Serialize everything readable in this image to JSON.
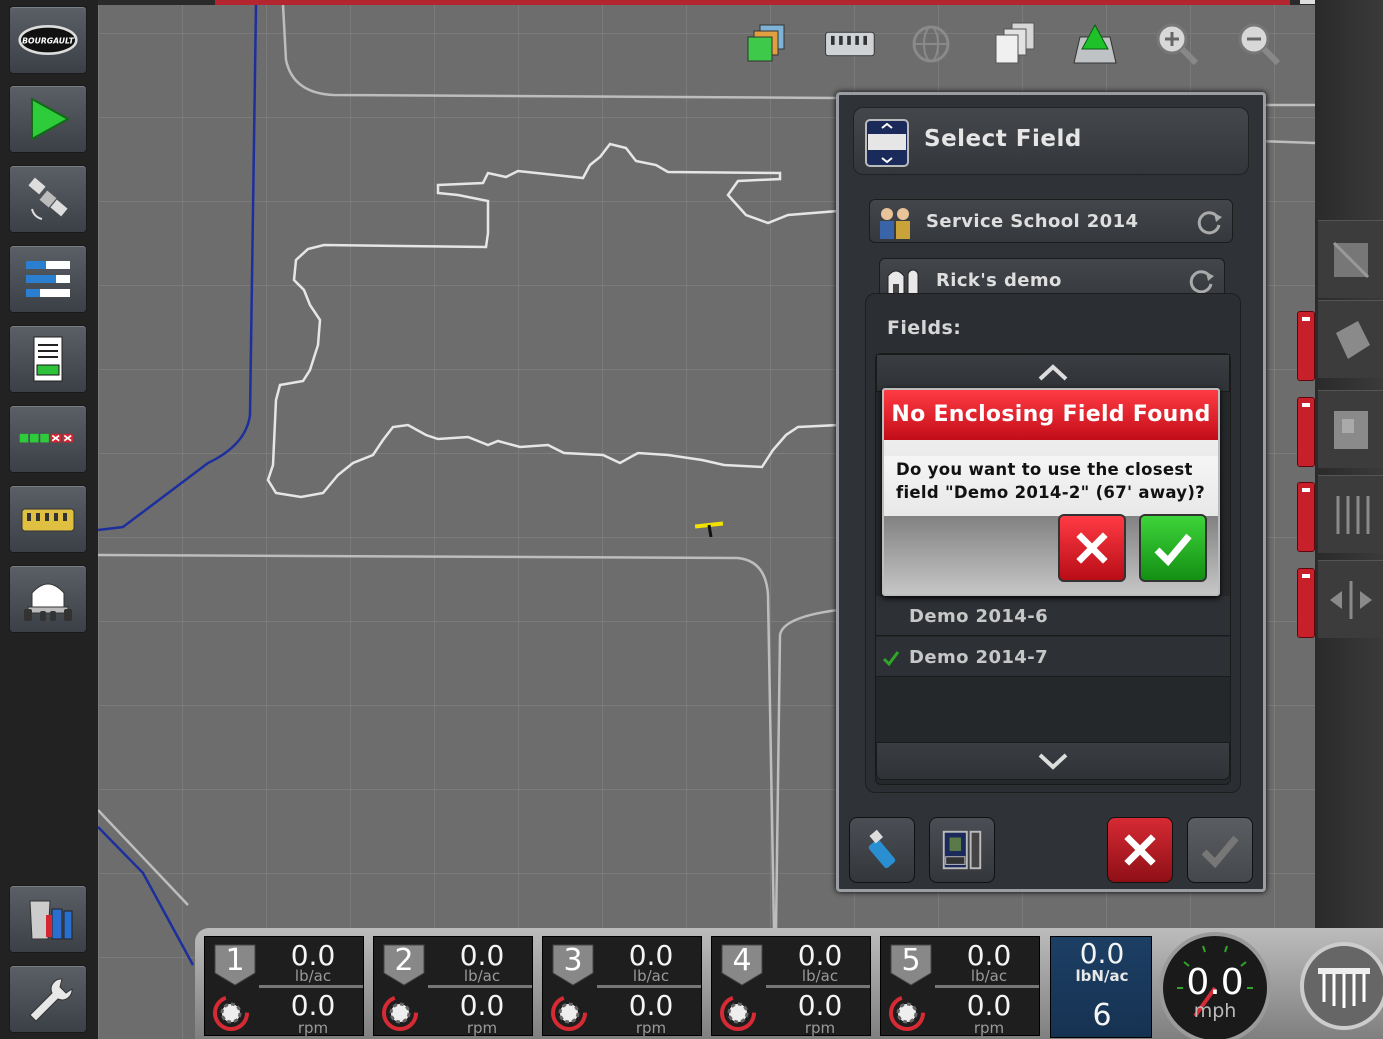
{
  "panel": {
    "title": "Select Field",
    "client": "Service School 2014",
    "farm": "Rick's demo",
    "fields_label": "Fields:",
    "fields": [
      {
        "name": "Demo 2014-6",
        "checked": false
      },
      {
        "name": "Demo 2014-7",
        "checked": true
      }
    ]
  },
  "dialog": {
    "title": "No Enclosing Field Found",
    "message": "Do you want to use the closest field \"Demo 2014-2\" (67' away)?"
  },
  "status": {
    "sections": [
      {
        "num": "1",
        "rate": "0.0",
        "rate_unit": "lb/ac",
        "speed": "0.0",
        "speed_unit": "rpm"
      },
      {
        "num": "2",
        "rate": "0.0",
        "rate_unit": "lb/ac",
        "speed": "0.0",
        "speed_unit": "rpm"
      },
      {
        "num": "3",
        "rate": "0.0",
        "rate_unit": "lb/ac",
        "speed": "0.0",
        "speed_unit": "rpm"
      },
      {
        "num": "4",
        "rate": "0.0",
        "rate_unit": "lb/ac",
        "speed": "0.0",
        "speed_unit": "rpm"
      },
      {
        "num": "5",
        "rate": "0.0",
        "rate_unit": "lb/ac",
        "speed": "0.0",
        "speed_unit": "rpm"
      }
    ],
    "nitrogen": {
      "value": "0.0",
      "unit": "lbN/ac",
      "count": "6"
    },
    "speed": {
      "value": "0.0",
      "unit": "mph"
    }
  },
  "brand": {
    "logo_text": "BOURGAULT"
  },
  "colors": {
    "accent_red": "#c8202b",
    "confirm_green": "#2fa52a",
    "map_bg": "#6d6d6d",
    "boundary_blue": "#1d2f9c"
  },
  "icons": {
    "left_toolbar": [
      "bourgault-logo",
      "guidance-play-icon",
      "gps-satellite-icon",
      "layers-list-icon",
      "job-report-icon",
      "section-status-icon",
      "implement-icon",
      "air-cart-icon",
      "tank-icon",
      "wrench-icon"
    ],
    "top_toolbar": [
      "map-layers-icon",
      "implement-view-icon",
      "globe-icon",
      "multi-page-icon",
      "field-view-icon",
      "zoom-in-icon",
      "zoom-out-icon"
    ],
    "right_toolbar": [
      "perspective-icon",
      "boundary-icon",
      "headland-icon",
      "guidelines-icon",
      "shift-icon"
    ]
  }
}
